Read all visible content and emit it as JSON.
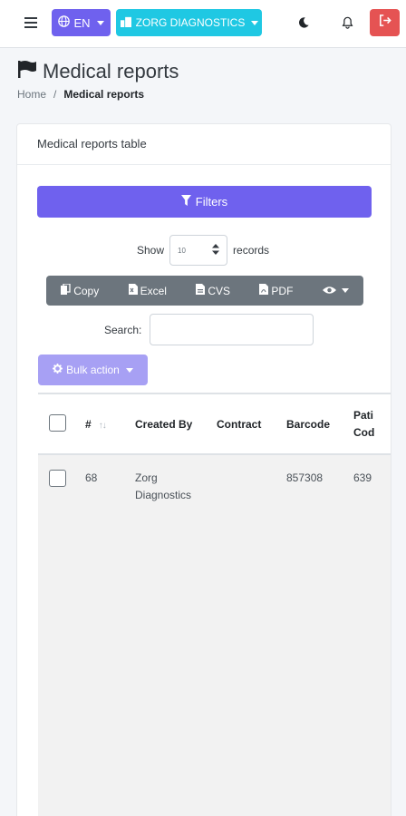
{
  "navbar": {
    "language": "EN",
    "organization": "ZORG DIAGNOSTICS"
  },
  "page": {
    "title": "Medical reports",
    "breadcrumb": [
      "Home",
      "/",
      "Medical reports"
    ]
  },
  "card": {
    "title": "Medical reports table",
    "filters_label": "Filters",
    "show_label": "Show",
    "page_length": "10",
    "records_label": "records",
    "export_buttons": [
      "Copy",
      "Excel",
      "CVS",
      "PDF"
    ],
    "search_label": "Search:",
    "search_value": "",
    "bulk_action_label": "Bulk action"
  },
  "table": {
    "columns": [
      "#",
      "Created By",
      "Contract",
      "Barcode",
      "Pati",
      "Cod"
    ],
    "rows": [
      {
        "id": "68",
        "created_by_1": "Zorg",
        "created_by_2": "Diagnostics",
        "contract": "",
        "barcode": "857308",
        "patient_code": "639"
      }
    ]
  },
  "colors": {
    "primary": "#6f61ee",
    "info": "#1fc8e3",
    "danger": "#e55353",
    "secondary": "#6c757d"
  },
  "icons": [
    "menu-icon",
    "globe-icon",
    "building-icon",
    "moon-icon",
    "bell-icon",
    "logout-icon",
    "flag-icon",
    "filter-icon",
    "copy-icon",
    "excel-icon",
    "csv-icon",
    "pdf-icon",
    "eye-icon",
    "gear-icon",
    "sort-icon"
  ]
}
